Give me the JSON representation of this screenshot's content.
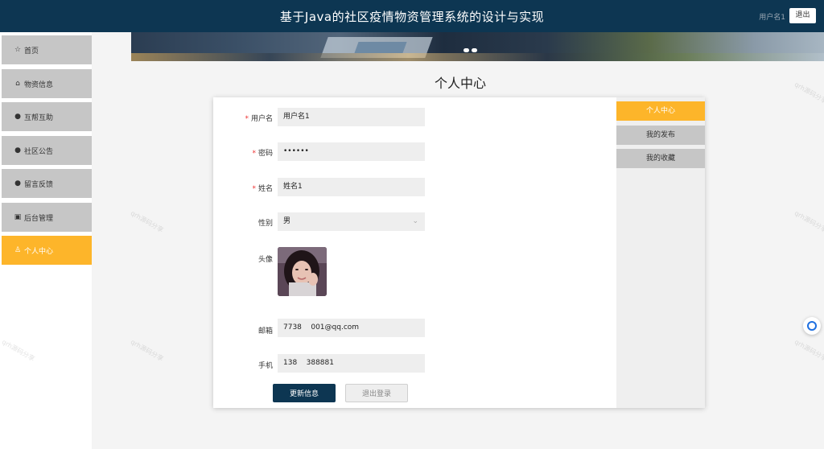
{
  "header": {
    "title": "基于Java的社区疫情物资管理系统的设计与实现",
    "username": "用户名1",
    "logout_label": "退出"
  },
  "sidebar": {
    "items": [
      {
        "label": "首页",
        "icon": "star-icon"
      },
      {
        "label": "物资信息",
        "icon": "bag-icon"
      },
      {
        "label": "互帮互助",
        "icon": "info-circle-icon"
      },
      {
        "label": "社区公告",
        "icon": "question-circle-icon"
      },
      {
        "label": "留言反馈",
        "icon": "info-circle-icon"
      },
      {
        "label": "后台管理",
        "icon": "calendar-icon"
      },
      {
        "label": "个人中心",
        "icon": "user-icon",
        "active": true
      }
    ]
  },
  "page": {
    "title": "个人中心"
  },
  "form": {
    "username": {
      "label": "用户名",
      "required": true,
      "value": "用户名1"
    },
    "password": {
      "label": "密码",
      "required": true,
      "value": "••••••"
    },
    "name": {
      "label": "姓名",
      "required": true,
      "value": "姓名1"
    },
    "gender": {
      "label": "性别",
      "required": false,
      "value": "男"
    },
    "avatar": {
      "label": "头像"
    },
    "email": {
      "label": "邮箱",
      "value": "7738    001@qq.com"
    },
    "phone": {
      "label": "手机",
      "value": "138    388881"
    },
    "update_label": "更新信息",
    "logout_label": "退出登录"
  },
  "side_tabs": [
    {
      "label": "个人中心",
      "active": true
    },
    {
      "label": "我的发布"
    },
    {
      "label": "我的收藏"
    }
  ],
  "colors": {
    "header_bg": "#0d3652",
    "accent": "#fdb52a",
    "nav_bg": "#c6c6c6",
    "required": "#ee3333"
  }
}
